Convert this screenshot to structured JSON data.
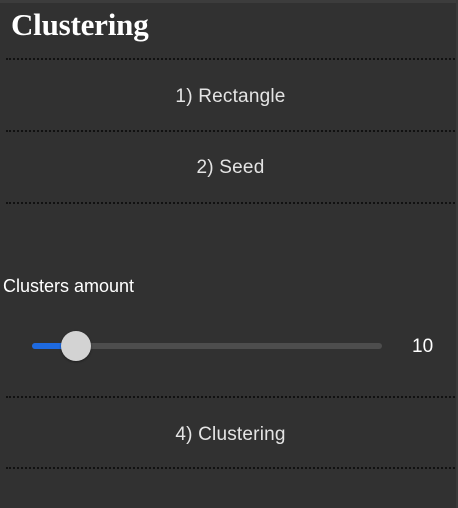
{
  "panel": {
    "title": "Clustering"
  },
  "steps": [
    {
      "label": "1) Rectangle"
    },
    {
      "label": "2) Seed"
    },
    {
      "label": "4) Clustering"
    }
  ],
  "slider": {
    "label": "Clusters amount",
    "value": "10",
    "fill_fraction": 0.125,
    "fill_color": "#1e6ae0",
    "track_color": "#4d4d4d",
    "thumb_color": "#d3d3d3"
  }
}
